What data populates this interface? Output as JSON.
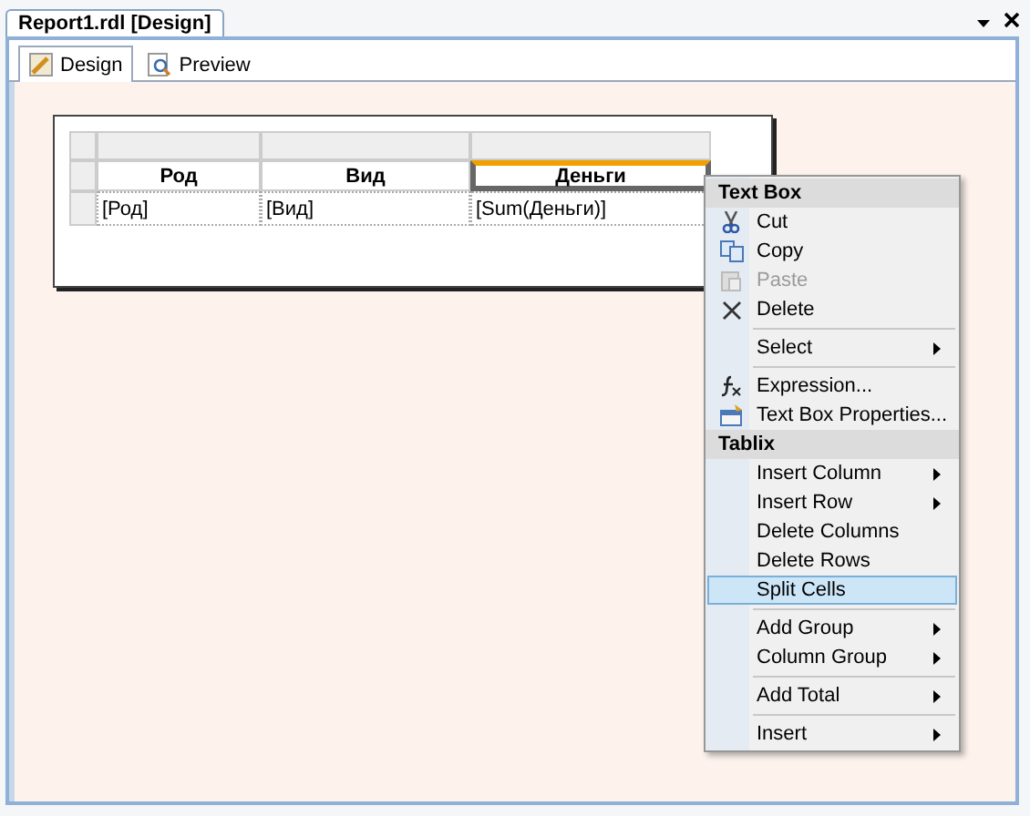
{
  "document_tab": {
    "title": "Report1.rdl [Design]"
  },
  "view_tabs": [
    {
      "label": "Design",
      "selected": true
    },
    {
      "label": "Preview",
      "selected": false
    }
  ],
  "table": {
    "headers": [
      {
        "label": "Род",
        "selected": false
      },
      {
        "label": "Вид",
        "selected": false
      },
      {
        "label": "Деньги",
        "selected": true
      }
    ],
    "cells": [
      "[Род]",
      "[Вид]",
      "[Sum(Деньги)]"
    ]
  },
  "context_menu": [
    {
      "kind": "header",
      "label": "Text Box"
    },
    {
      "kind": "item",
      "label": "Cut",
      "disabled": false,
      "selected": false,
      "submenu": false
    },
    {
      "kind": "item",
      "label": "Copy",
      "disabled": false,
      "selected": false,
      "submenu": false
    },
    {
      "kind": "item",
      "label": "Paste",
      "disabled": true,
      "selected": false,
      "submenu": false
    },
    {
      "kind": "item",
      "label": "Delete",
      "disabled": false,
      "selected": false,
      "submenu": false
    },
    {
      "kind": "separator"
    },
    {
      "kind": "item",
      "label": "Select",
      "disabled": false,
      "selected": false,
      "submenu": true
    },
    {
      "kind": "separator"
    },
    {
      "kind": "item",
      "label": "Expression...",
      "disabled": false,
      "selected": false,
      "submenu": false
    },
    {
      "kind": "item",
      "label": "Text Box Properties...",
      "disabled": false,
      "selected": false,
      "submenu": false
    },
    {
      "kind": "header",
      "label": "Tablix"
    },
    {
      "kind": "item",
      "label": "Insert Column",
      "disabled": false,
      "selected": false,
      "submenu": true
    },
    {
      "kind": "item",
      "label": "Insert Row",
      "disabled": false,
      "selected": false,
      "submenu": true
    },
    {
      "kind": "item",
      "label": "Delete Columns",
      "disabled": false,
      "selected": false,
      "submenu": false
    },
    {
      "kind": "item",
      "label": "Delete Rows",
      "disabled": false,
      "selected": false,
      "submenu": false
    },
    {
      "kind": "item",
      "label": "Split Cells",
      "disabled": false,
      "selected": true,
      "submenu": false
    },
    {
      "kind": "separator"
    },
    {
      "kind": "item",
      "label": "Add Group",
      "disabled": false,
      "selected": false,
      "submenu": true
    },
    {
      "kind": "item",
      "label": "Column Group",
      "disabled": false,
      "selected": false,
      "submenu": true
    },
    {
      "kind": "separator"
    },
    {
      "kind": "item",
      "label": "Add Total",
      "disabled": false,
      "selected": false,
      "submenu": true
    },
    {
      "kind": "separator"
    },
    {
      "kind": "item",
      "label": "Insert",
      "disabled": false,
      "selected": false,
      "submenu": true
    }
  ]
}
